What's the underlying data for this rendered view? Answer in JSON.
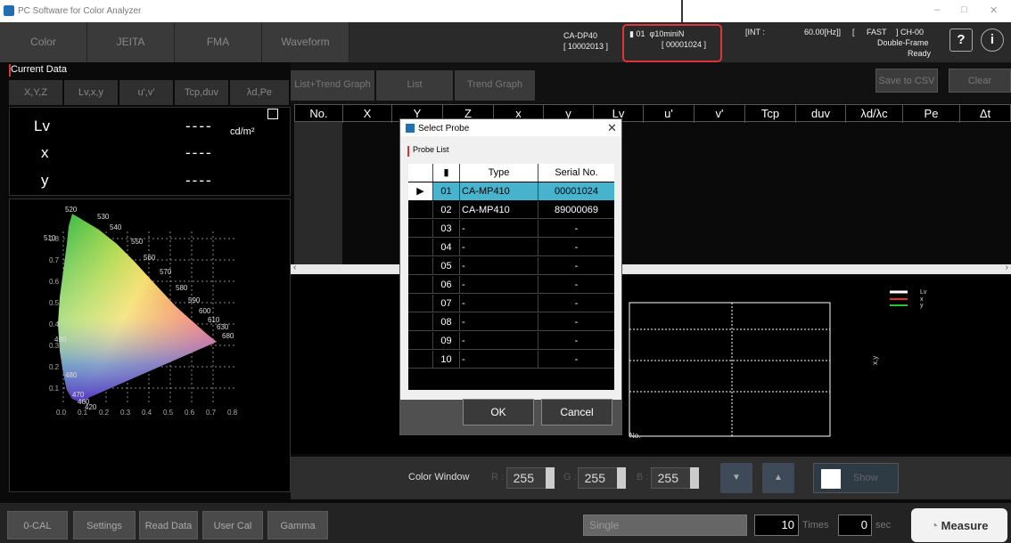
{
  "window": {
    "title": "PC Software for Color Analyzer",
    "min": "–",
    "max": "□",
    "close": "✕"
  },
  "top_tabs": [
    "Color",
    "JEITA",
    "FMA",
    "Waveform"
  ],
  "device": {
    "model": "CA-DP40",
    "serial": "[ 10002013 ]"
  },
  "probe": {
    "num": "01",
    "name": "φ10miniN",
    "serial": "[ 00001024 ]"
  },
  "settings": {
    "int": "[INT :",
    "freq": "60.00[Hz]]",
    "bracket": "[",
    "speed": "FAST",
    "ch": "] CH-00",
    "frame": "Double-Frame",
    "status": "Ready"
  },
  "help_btn": "?",
  "info_btn": "i",
  "left": {
    "current_data": "Current Data",
    "tabs": [
      "X,Y,Z",
      "Lv,x,y",
      "u',v'",
      "Tcp,duv",
      "λd,Pe"
    ],
    "rows": [
      {
        "label": "Lv",
        "value": "----",
        "unit": "cd/m²"
      },
      {
        "label": "x",
        "value": "----",
        "unit": ""
      },
      {
        "label": "y",
        "value": "----",
        "unit": ""
      }
    ],
    "cie_wavelengths": [
      "520",
      "530",
      "540",
      "510",
      "550",
      "560",
      "570",
      "580",
      "590",
      "600",
      "610",
      "630",
      "680",
      "490",
      "480",
      "470",
      "460",
      "420"
    ],
    "cie_x_ticks": [
      "0.0",
      "0.1",
      "0.2",
      "0.3",
      "0.4",
      "0.5",
      "0.6",
      "0.7",
      "0.8"
    ],
    "cie_y_ticks": [
      "0.8",
      "0.7",
      "0.6",
      "0.5",
      "0.4",
      "0.3",
      "0.2",
      "0.1"
    ]
  },
  "right": {
    "tabs": [
      "List+Trend Graph",
      "List",
      "Trend Graph"
    ],
    "save_csv": "Save to CSV",
    "clear": "Clear",
    "columns": [
      "No.",
      "X",
      "Y",
      "Z",
      "x",
      "y",
      "Lv",
      "u'",
      "v'",
      "Tcp",
      "duv",
      "λd/λc",
      "Pe",
      "Δt"
    ],
    "legend": [
      "Lv",
      "x",
      "y"
    ],
    "legend_colors": [
      "#ffffff",
      "#e03030",
      "#30c030"
    ],
    "graph_xlabel": "No.",
    "graph_ylabel": "x,y"
  },
  "color_window": {
    "label": "Color Window",
    "r_label": "R :",
    "r": "255",
    "g_label": "G :",
    "g": "255",
    "b_label": "B :",
    "b": "255",
    "show": "Show",
    "down": "▼",
    "up": "▲"
  },
  "bottom": {
    "buttons": [
      "0-CAL",
      "Settings",
      "Read Data",
      "User Cal",
      "Gamma"
    ],
    "mode": "Single",
    "times": "10",
    "times_label": "Times",
    "sec": "0",
    "sec_label": "sec",
    "measure": "Measure"
  },
  "dialog": {
    "title": "Select Probe",
    "close": "✕",
    "list_label": "Probe List",
    "headers": [
      "",
      "",
      "Type",
      "Serial No."
    ],
    "selected_marker": "▶",
    "rows": [
      {
        "num": "01",
        "type": "CA-MP410",
        "serial": "00001024"
      },
      {
        "num": "02",
        "type": "CA-MP410",
        "serial": "89000069"
      },
      {
        "num": "03",
        "type": "-",
        "serial": "-"
      },
      {
        "num": "04",
        "type": "-",
        "serial": "-"
      },
      {
        "num": "05",
        "type": "-",
        "serial": "-"
      },
      {
        "num": "06",
        "type": "-",
        "serial": "-"
      },
      {
        "num": "07",
        "type": "-",
        "serial": "-"
      },
      {
        "num": "08",
        "type": "-",
        "serial": "-"
      },
      {
        "num": "09",
        "type": "-",
        "serial": "-"
      },
      {
        "num": "10",
        "type": "-",
        "serial": "-"
      }
    ],
    "ok": "OK",
    "cancel": "Cancel"
  }
}
